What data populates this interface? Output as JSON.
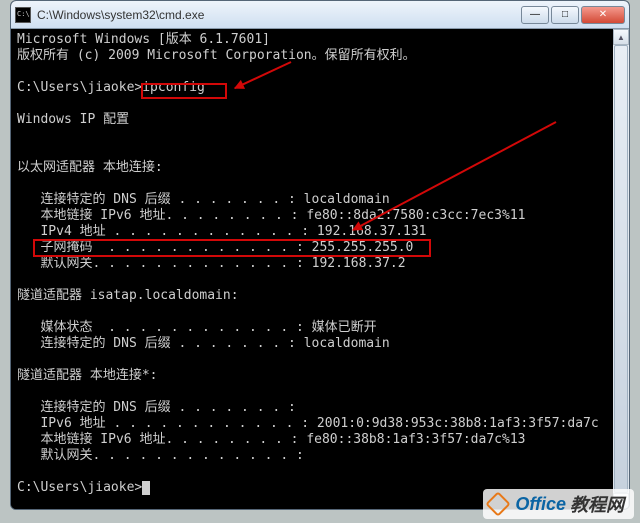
{
  "title": "C:\\Windows\\system32\\cmd.exe",
  "term": {
    "l1": "Microsoft Windows [版本 6.1.7601]",
    "l2": "版权所有 (c) 2009 Microsoft Corporation。保留所有权利。",
    "prompt1": "C:\\Users\\jiaoke>",
    "cmd1": "ipconfig",
    "l3": "Windows IP 配置",
    "l4": "以太网适配器 本地连接:",
    "l5": "   连接特定的 DNS 后缀 . . . . . . . : localdomain",
    "l6": "   本地链接 IPv6 地址. . . . . . . . : fe80::8da2:7580:c3cc:7ec3%11",
    "l7": "   IPv4 地址 . . . . . . . . . . . . : 192.168.37.131",
    "l8": "   子网掩码  . . . . . . . . . . . . : 255.255.255.0",
    "l9": "   默认网关. . . . . . . . . . . . . : 192.168.37.2",
    "l10": "隧道适配器 isatap.localdomain:",
    "l11": "   媒体状态  . . . . . . . . . . . . : 媒体已断开",
    "l12": "   连接特定的 DNS 后缀 . . . . . . . : localdomain",
    "l13": "隧道适配器 本地连接*:",
    "l14": "   连接特定的 DNS 后缀 . . . . . . . :",
    "l15": "   IPv6 地址 . . . . . . . . . . . . : 2001:0:9d38:953c:38b8:1af3:3f57:da7c",
    "l16": "   本地链接 IPv6 地址. . . . . . . . : fe80::38b8:1af3:3f57:da7c%13",
    "l17": "   默认网关. . . . . . . . . . . . . :",
    "prompt2": "C:\\Users\\jiaoke>"
  },
  "watermark": {
    "text": "Office",
    "suffix": "教程网"
  },
  "buttons": {
    "min": "—",
    "max": "□",
    "close": "✕"
  },
  "arrows": {
    "up": "▲",
    "down": "▼"
  }
}
